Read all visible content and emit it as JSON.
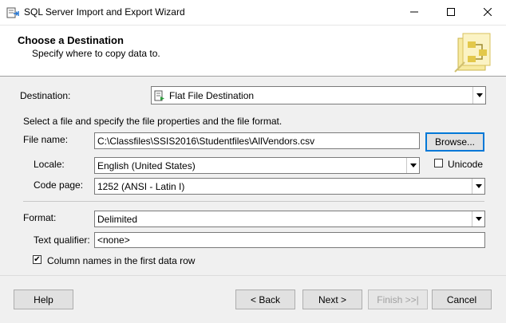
{
  "window": {
    "title": "SQL Server Import and Export Wizard",
    "minimize": "─",
    "maximize": "☐",
    "close": "✕"
  },
  "header": {
    "title": "Choose a Destination",
    "subtitle": "Specify where to copy data to."
  },
  "destination": {
    "label": "Destination:",
    "value": "Flat File Destination"
  },
  "instructions": "Select a file and specify the file properties and the file format.",
  "file_name": {
    "label": "File name:",
    "value": "C:\\Classfiles\\SSIS2016\\Studentfiles\\AllVendors.csv",
    "browse_label": "Browse..."
  },
  "locale": {
    "label": "Locale:",
    "value": "English (United States)"
  },
  "unicode": {
    "label": "Unicode",
    "checked": false
  },
  "code_page": {
    "label": "Code page:",
    "value": "1252  (ANSI - Latin I)"
  },
  "format": {
    "label": "Format:",
    "value": "Delimited"
  },
  "text_qualifier": {
    "label": "Text qualifier:",
    "value": "<none>"
  },
  "column_names": {
    "label": "Column names in the first data row",
    "checked": true,
    "mark": "✔"
  },
  "buttons": {
    "help": "Help",
    "back": "< Back",
    "next": "Next >",
    "finish": "Finish >>|",
    "cancel": "Cancel"
  }
}
